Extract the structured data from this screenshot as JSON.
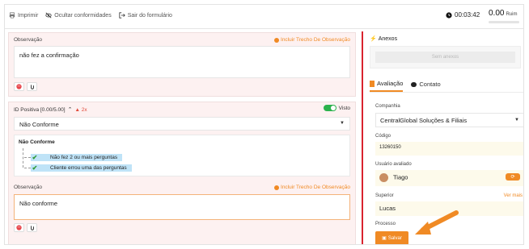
{
  "topbar": {
    "print_label": "Imprimir",
    "hide_label": "Ocultar conformidades",
    "exit_label": "Sair do formulário",
    "timer": "00:03:42",
    "score": "0.00",
    "rating": "Ruim"
  },
  "observation1": {
    "label": "Observação",
    "include_link": "Incluir Trecho De Observação",
    "text": "não fez a confirmação"
  },
  "criterion": {
    "title": "ID Positiva [0.00/5.00]",
    "warning_count": "2x",
    "visto_label": "Visto",
    "selected": "Não Conforme",
    "tree_title": "Não Conforme",
    "tree_items": [
      "Não fez 2 ou mais perguntas",
      "Cliente errou uma das perguntas"
    ]
  },
  "observation2": {
    "label": "Observação",
    "include_link": "Incluir Trecho De Observação",
    "text": "Não conforme"
  },
  "sidebar": {
    "anexos_label": "Anexos",
    "anexos_button": "Sem anexos",
    "tabs": [
      {
        "label": "Avaliação",
        "active": true
      },
      {
        "label": "Contato",
        "active": false
      }
    ],
    "company_label": "Companhia",
    "company_value": "CentralGlobal Soluções & Filiais",
    "code_label": "Código",
    "code_value": "13260150",
    "user_label": "Usuário avaliado",
    "user_value": "Tiago",
    "superior_label": "Superior",
    "superior_more": "Ver mais",
    "superior_value": "Lucas",
    "process_label": "Processo",
    "save_label": "Salvar"
  },
  "colors": {
    "accent": "#f08a24",
    "divider": "#d9232e",
    "toggle_on": "#2bb24c"
  }
}
